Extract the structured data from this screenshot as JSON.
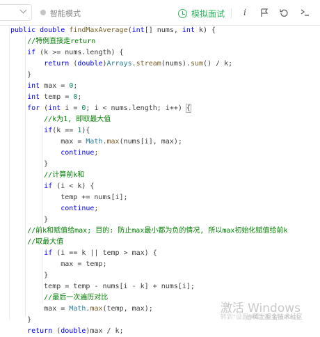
{
  "toolbar": {
    "smart_mode_label": "智能模式",
    "mock_interview_label": "模拟面试",
    "icons": [
      "info-icon",
      "flag-icon",
      "reset-icon",
      "terminal-icon"
    ]
  },
  "code_lines": [
    "public double findMaxAverage(int[] nums, int k) {",
    "    //特例直接走return",
    "    if (k >= nums.length) {",
    "        return (double)Arrays.stream(nums).sum() / k;",
    "    }",
    "    int max = 0;",
    "    int temp = 0;",
    "    for (int i = 0; i < nums.length; i++) {",
    "        //k为1, 即取最大值",
    "        if(k == 1){",
    "            max = Math.max(nums[i], max);",
    "            continue;",
    "        }",
    "        //计算前k和",
    "        if (i < k) {",
    "            temp += nums[i];",
    "            continue;",
    "        }",
    "    //前k和赋值给max; 目的: 防止max最小都为负的情况, 所以max初始化赋值给前k",
    "    //取最大值",
    "        if (i == k || temp > max) {",
    "            max = temp;",
    "        }",
    "        temp = temp - nums[i - k] + nums[i];",
    "        //最后一次遍历对比",
    "        max = Math.max(temp, max);",
    "    }",
    "    return (double)max / k;"
  ],
  "watermark": {
    "title": "激活 Windows",
    "subtitle": "转到\"设置\"以激活 Windows"
  },
  "credit": "@稀土掘金技术社区"
}
